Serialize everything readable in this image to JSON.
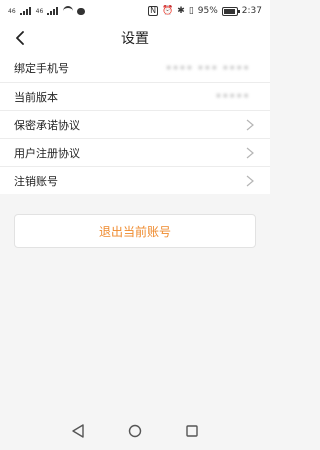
{
  "status_bar": {
    "left_labels": [
      "46",
      "46",
      "4G"
    ],
    "battery_percent_text": "95%",
    "time": "2:37"
  },
  "header": {
    "title": "设置"
  },
  "list": {
    "items": [
      {
        "label": "绑定手机号",
        "value": "•••• ••• ••••"
      },
      {
        "label": "当前版本",
        "value": "•••••"
      },
      {
        "label": "保密承诺协议"
      },
      {
        "label": "用户注册协议"
      },
      {
        "label": "注销账号"
      }
    ]
  },
  "actions": {
    "logout_label": "退出当前账号"
  },
  "colors": {
    "accent": "#ef8a2d",
    "text": "#222222",
    "divider": "#ececec",
    "background": "#f5f5f5"
  },
  "icons": [
    "back-icon",
    "chevron-right-icon",
    "nav-back-icon",
    "nav-home-icon",
    "nav-recents-icon"
  ]
}
